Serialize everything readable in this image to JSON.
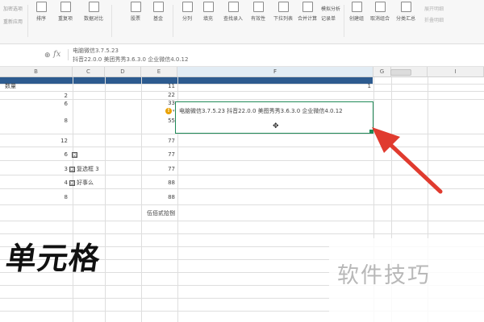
{
  "ribbon": {
    "top_left_1": "加密选项",
    "top_left_2": "重新应用",
    "buttons": [
      {
        "label": "排序"
      },
      {
        "label": "重复项"
      },
      {
        "label": "数据对比"
      },
      {
        "label": "股票"
      },
      {
        "label": "基金"
      },
      {
        "label": "分列"
      },
      {
        "label": "填充"
      },
      {
        "label": "查找录入"
      },
      {
        "label": "有效性"
      },
      {
        "label": "下拉列表"
      },
      {
        "label": "合并计算"
      },
      {
        "label": "模拟分析"
      },
      {
        "label": "记录单"
      },
      {
        "label": "创建组"
      },
      {
        "label": "取消组合"
      },
      {
        "label": "分类汇总"
      },
      {
        "label": "展开明细"
      },
      {
        "label": "折叠明细"
      }
    ]
  },
  "formula_bar": {
    "zoom_icon_label": "⊕",
    "fx_label": "fx",
    "line1": "电脑微信3.7.5.23",
    "line2": "抖音22.0.0 美团秀秀3.6.3.0 企业微信4.0.12"
  },
  "columns": [
    "B",
    "C",
    "D",
    "E",
    "F",
    "G",
    "H",
    "I"
  ],
  "cells": {
    "b1_header": "数量",
    "e1": "11",
    "i1": "1",
    "b2": "2",
    "e2": "22",
    "b3": "6",
    "e3": "33",
    "b4": "8",
    "e4": "55",
    "b5": "12",
    "e5": "77",
    "b6": "6",
    "e6": "77",
    "b7": "3",
    "c7": "复选框 3",
    "e7": "77",
    "b8": "4",
    "c8": "好事么",
    "e8": "88",
    "b9": "8",
    "e9": "88",
    "e10": "伍佰贰拾捌",
    "f_merged": "电脑微信3.7.5.23  抖音22.0.0 美图秀秀3.6.3.0 企业微信4.0.12"
  },
  "checkbox_glyph": "☑",
  "warning_glyph": "!",
  "warning_dropdown": "▾",
  "cursor_glyph": "✥",
  "overlay_text": "单元格",
  "watermark_text": "软件技巧",
  "colors": {
    "selection_border": "#1f8a57",
    "header_blue": "#2d5b8f",
    "arrow_red": "#e03b2f",
    "warning": "#e9a100"
  }
}
